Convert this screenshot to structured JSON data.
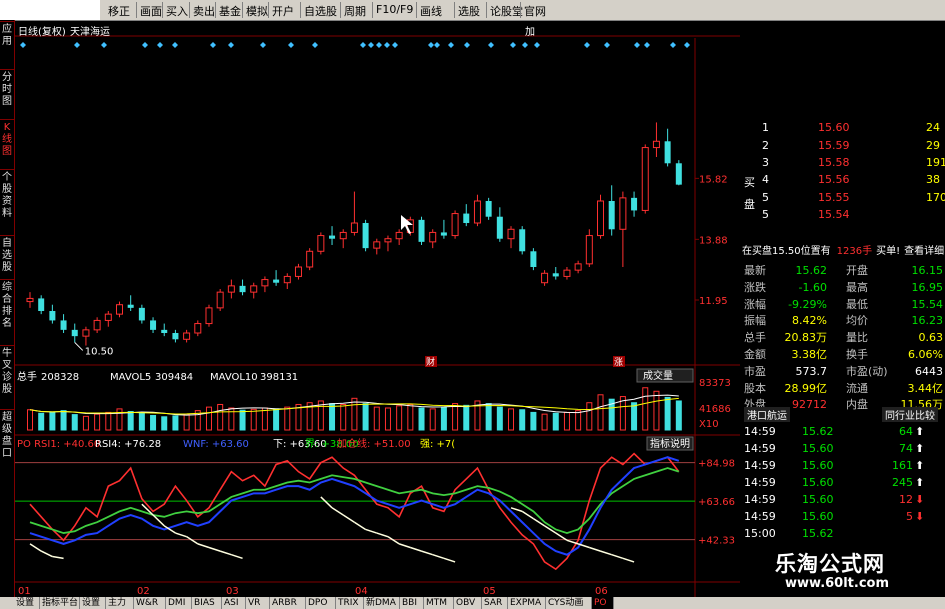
{
  "toolbar": {
    "items": [
      "移正",
      "画面",
      "买入",
      "卖出",
      "基金",
      "模拟",
      "开户",
      "自选股",
      "周期",
      "F10/F9",
      "画线",
      "选股",
      "论股堂",
      "官网"
    ]
  },
  "left_tabs": [
    {
      "label": "应用",
      "active": false
    },
    {
      "label": "分时图",
      "active": false
    },
    {
      "label": "K线图",
      "active": true
    },
    {
      "label": "个股资料",
      "active": false
    },
    {
      "label": "自选股",
      "active": false
    },
    {
      "label": "综合排名",
      "active": false
    },
    {
      "label": "牛叉诊股",
      "active": false
    },
    {
      "label": "超级盘口",
      "active": false
    }
  ],
  "chart": {
    "header": {
      "period": "日线(复权)",
      "name": "天津海运",
      "tail": "加"
    },
    "price_ticks": [
      "15.82",
      "13.88",
      "11.95"
    ],
    "low_label": "10.50",
    "event_labels": [
      "财",
      "涨"
    ],
    "volume": {
      "total_label": "总手",
      "total": "208328",
      "ma5_label": "MAVOL5",
      "ma5": "309484",
      "ma10_label": "MAVOL10",
      "ma10": "398131",
      "ticks": [
        "83373",
        "41686",
        "X10"
      ],
      "dropdown": "成交量"
    },
    "indicator": {
      "items": [
        {
          "text": "PO RSI1: +40.60",
          "color": "#ff3030"
        },
        {
          "text": "RSI4: +76.28",
          "color": "#ffffff"
        },
        {
          "text": "WNF: +63.60",
          "color": "#4060ff"
        },
        {
          "text": "下: +63.60",
          "color": "#ffffff"
        },
        {
          "text": "界: +38.00",
          "color": "#00e000"
        },
        {
          "text": "加仓线: +51.00",
          "color": "#ff3030"
        },
        {
          "text": "强: +7(",
          "color": "#ffff00"
        }
      ],
      "ticks": [
        "+84.98",
        "+63.66",
        "+42.33"
      ],
      "button": "指标说明"
    },
    "x_labels": [
      "01",
      "02",
      "03",
      "04",
      "05",
      "06"
    ],
    "candles": [
      [
        11.9,
        12.2,
        11.7,
        12.0
      ],
      [
        12.0,
        12.1,
        11.5,
        11.6
      ],
      [
        11.6,
        11.8,
        11.2,
        11.3
      ],
      [
        11.3,
        11.5,
        10.9,
        11.0
      ],
      [
        11.0,
        11.2,
        10.6,
        10.8
      ],
      [
        10.8,
        11.1,
        10.5,
        11.0
      ],
      [
        11.0,
        11.4,
        10.9,
        11.3
      ],
      [
        11.3,
        11.6,
        11.1,
        11.5
      ],
      [
        11.5,
        11.9,
        11.4,
        11.8
      ],
      [
        11.8,
        12.1,
        11.6,
        11.7
      ],
      [
        11.7,
        11.8,
        11.2,
        11.3
      ],
      [
        11.3,
        11.4,
        10.9,
        11.0
      ],
      [
        11.0,
        11.2,
        10.8,
        10.9
      ],
      [
        10.9,
        11.0,
        10.6,
        10.7
      ],
      [
        10.7,
        11.0,
        10.6,
        10.9
      ],
      [
        10.9,
        11.3,
        10.8,
        11.2
      ],
      [
        11.2,
        11.8,
        11.1,
        11.7
      ],
      [
        11.7,
        12.3,
        11.6,
        12.2
      ],
      [
        12.2,
        12.6,
        12.0,
        12.4
      ],
      [
        12.4,
        12.6,
        12.1,
        12.2
      ],
      [
        12.2,
        12.5,
        12.0,
        12.4
      ],
      [
        12.4,
        12.7,
        12.2,
        12.6
      ],
      [
        12.6,
        12.9,
        12.4,
        12.5
      ],
      [
        12.5,
        12.8,
        12.3,
        12.7
      ],
      [
        12.7,
        13.1,
        12.6,
        13.0
      ],
      [
        13.0,
        13.6,
        12.9,
        13.5
      ],
      [
        13.5,
        14.1,
        13.4,
        14.0
      ],
      [
        14.0,
        14.3,
        13.7,
        13.9
      ],
      [
        13.9,
        14.2,
        13.6,
        14.1
      ],
      [
        14.1,
        15.4,
        14.0,
        14.4
      ],
      [
        14.4,
        14.5,
        13.5,
        13.6
      ],
      [
        13.6,
        13.9,
        13.4,
        13.8
      ],
      [
        13.8,
        14.0,
        13.5,
        13.9
      ],
      [
        13.9,
        14.2,
        13.7,
        14.1
      ],
      [
        14.1,
        14.6,
        14.0,
        14.5
      ],
      [
        14.5,
        14.6,
        13.7,
        13.8
      ],
      [
        13.8,
        14.2,
        13.6,
        14.1
      ],
      [
        14.1,
        14.5,
        13.9,
        14.0
      ],
      [
        14.0,
        14.8,
        13.9,
        14.7
      ],
      [
        14.7,
        15.0,
        14.3,
        14.4
      ],
      [
        14.4,
        15.3,
        14.3,
        15.1
      ],
      [
        15.1,
        15.2,
        14.5,
        14.6
      ],
      [
        14.6,
        14.9,
        13.8,
        13.9
      ],
      [
        13.9,
        14.3,
        13.6,
        14.2
      ],
      [
        14.2,
        14.3,
        13.4,
        13.5
      ],
      [
        13.5,
        13.6,
        12.9,
        13.0
      ],
      [
        12.5,
        12.9,
        12.4,
        12.8
      ],
      [
        12.8,
        13.0,
        12.6,
        12.7
      ],
      [
        12.7,
        13.0,
        12.6,
        12.9
      ],
      [
        12.9,
        13.2,
        12.8,
        13.1
      ],
      [
        13.1,
        14.2,
        13.0,
        14.0
      ],
      [
        14.0,
        15.3,
        13.9,
        15.1
      ],
      [
        15.1,
        15.6,
        14.0,
        14.2
      ],
      [
        14.2,
        15.4,
        13.0,
        15.2
      ],
      [
        15.2,
        15.4,
        14.6,
        14.8
      ],
      [
        14.8,
        16.9,
        14.7,
        16.8
      ],
      [
        16.8,
        17.6,
        16.5,
        17.0
      ],
      [
        17.0,
        17.4,
        16.2,
        16.3
      ],
      [
        16.3,
        16.4,
        15.6,
        15.62
      ]
    ],
    "volumes": [
      46,
      38,
      40,
      44,
      35,
      31,
      36,
      40,
      48,
      42,
      38,
      33,
      30,
      32,
      36,
      44,
      52,
      58,
      50,
      45,
      47,
      50,
      48,
      52,
      58,
      62,
      66,
      60,
      58,
      72,
      60,
      52,
      50,
      55,
      58,
      50,
      48,
      52,
      60,
      56,
      66,
      60,
      52,
      48,
      46,
      40,
      36,
      38,
      40,
      44,
      62,
      80,
      70,
      76,
      62,
      96,
      88,
      74,
      66
    ],
    "rsi1": [
      62,
      55,
      48,
      42,
      50,
      60,
      55,
      72,
      75,
      82,
      65,
      58,
      62,
      72,
      64,
      55,
      60,
      70,
      80,
      75,
      78,
      72,
      84,
      86,
      80,
      76,
      85,
      88,
      82,
      78,
      70,
      62,
      60,
      55,
      68,
      72,
      60,
      58,
      70,
      76,
      82,
      70,
      60,
      52,
      45,
      40,
      30,
      26,
      32,
      42,
      64,
      82,
      88,
      84,
      90,
      84,
      86,
      88,
      80
    ],
    "rsi4": [
      52,
      50,
      48,
      46,
      47,
      50,
      52,
      55,
      58,
      60,
      58,
      56,
      55,
      57,
      58,
      57,
      58,
      62,
      66,
      68,
      70,
      70,
      72,
      74,
      75,
      74,
      76,
      78,
      77,
      76,
      74,
      72,
      70,
      68,
      69,
      70,
      68,
      67,
      68,
      70,
      72,
      71,
      69,
      66,
      62,
      58,
      52,
      48,
      46,
      48,
      54,
      62,
      68,
      72,
      76,
      78,
      80,
      82,
      80
    ],
    "wnf": [
      46,
      44,
      42,
      40,
      42,
      45,
      46,
      50,
      54,
      56,
      54,
      50,
      48,
      50,
      52,
      50,
      52,
      58,
      64,
      66,
      68,
      68,
      70,
      72,
      72,
      70,
      74,
      76,
      74,
      72,
      68,
      64,
      62,
      60,
      62,
      64,
      62,
      60,
      62,
      66,
      70,
      68,
      64,
      58,
      52,
      46,
      40,
      36,
      34,
      38,
      48,
      60,
      70,
      76,
      82,
      84,
      86,
      88,
      86
    ],
    "yellowline": [
      40,
      36,
      33,
      32,
      42,
      44,
      48,
      54,
      58,
      60,
      62,
      56,
      50,
      46,
      44,
      40,
      38,
      36,
      34,
      32,
      44,
      48,
      54,
      58,
      62,
      64,
      66,
      60,
      56,
      52,
      48,
      46,
      44,
      40,
      38,
      36,
      34,
      32,
      30,
      52,
      54,
      56,
      58,
      60,
      58,
      54,
      50,
      46,
      42,
      40,
      38,
      36,
      34,
      32,
      30,
      52,
      54,
      56,
      58
    ]
  },
  "right_panel": {
    "buy_label": "买盘",
    "bids": [
      {
        "n": "1",
        "price": "15.60",
        "vol": "24"
      },
      {
        "n": "2",
        "price": "15.59",
        "vol": "29"
      },
      {
        "n": "3",
        "price": "15.58",
        "vol": "191"
      },
      {
        "n": "4",
        "price": "15.56",
        "vol": "38"
      },
      {
        "n": "5",
        "price": "15.55",
        "vol": "170"
      }
    ],
    "bid_extra": {
      "n": "5",
      "price": "15.54"
    },
    "notice": {
      "text": "在买盘15.50位置有",
      "vol": "1236手",
      "action": "买单!",
      "link": "查看详细"
    },
    "stats": [
      {
        "l1": "最新",
        "v1": "15.62",
        "c1": "green",
        "l2": "开盘",
        "v2": "16.15",
        "c2": "green"
      },
      {
        "l1": "涨跌",
        "v1": "-1.60",
        "c1": "green",
        "l2": "最高",
        "v2": "16.95",
        "c2": "green"
      },
      {
        "l1": "涨幅",
        "v1": "-9.29%",
        "c1": "green",
        "l2": "最低",
        "v2": "15.54",
        "c2": "green"
      },
      {
        "l1": "振幅",
        "v1": "8.42%",
        "c1": "yellow",
        "l2": "均价",
        "v2": "16.23",
        "c2": "green"
      },
      {
        "l1": "总手",
        "v1": "20.83万",
        "c1": "yellow",
        "l2": "量比",
        "v2": "0.63",
        "c2": "yellow"
      },
      {
        "l1": "金额",
        "v1": "3.38亿",
        "c1": "yellow",
        "l2": "换手",
        "v2": "6.06%",
        "c2": "yellow"
      },
      {
        "l1": "市盈",
        "v1": "573.7",
        "c1": "white",
        "l2": "市盈(动)",
        "v2": "6443",
        "c2": "white"
      },
      {
        "l1": "股本",
        "v1": "28.99亿",
        "c1": "yellow",
        "l2": "流通",
        "v2": "3.44亿",
        "c2": "yellow"
      },
      {
        "l1": "外盘",
        "v1": "92712",
        "c1": "red",
        "l2": "内盘",
        "v2": "11.56万",
        "c2": "yellow"
      }
    ],
    "tabs": [
      "港口航运",
      "同行业比较"
    ],
    "ticks": [
      {
        "t": "14:59",
        "p": "15.62",
        "v": "64",
        "dir": "up"
      },
      {
        "t": "14:59",
        "p": "15.60",
        "v": "74",
        "dir": "up"
      },
      {
        "t": "14:59",
        "p": "15.60",
        "v": "161",
        "dir": "up"
      },
      {
        "t": "14:59",
        "p": "15.60",
        "v": "245",
        "dir": "up"
      },
      {
        "t": "14:59",
        "p": "15.60",
        "v": "12",
        "dir": "down"
      },
      {
        "t": "14:59",
        "p": "15.60",
        "v": "5",
        "dir": "down"
      },
      {
        "t": "15:00",
        "p": "15.62",
        "v": "",
        "dir": ""
      }
    ]
  },
  "bottom_tabs": [
    "设置",
    "指标平台",
    "设置",
    "主力",
    "W&R",
    "DMI",
    "BIAS",
    "ASI",
    "VR",
    "ARBR",
    "DPO",
    "TRIX",
    "新DMA",
    "BBI",
    "MTM",
    "OBV",
    "SAR",
    "EXPMA",
    "CYS动画",
    "PO"
  ],
  "watermark": {
    "title": "乐淘公式网",
    "url": "www.60lt.com"
  }
}
